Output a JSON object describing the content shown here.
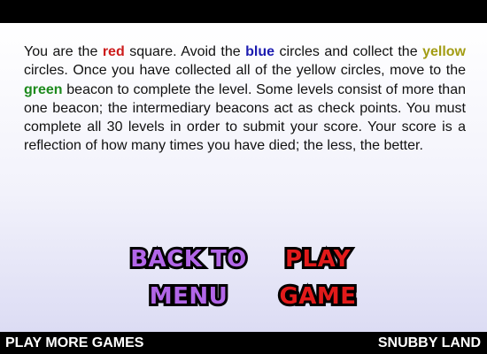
{
  "instructions": {
    "p1": "You are the ",
    "red_word": "red",
    "p2": " square.  Avoid the ",
    "blue_word": "blue",
    "p3": " circles and collect the ",
    "yellow_word": "yellow",
    "p4": " circles.  Once you have collected all of the yellow circles, move to the ",
    "green_word": "green",
    "p5": " beacon to complete the level. Some levels consist of more than one beacon; the intermediary beacons act as check points.  You must complete all 30 levels in order to submit your score.  Your score is a reflection of how many times you have died; the less, the better."
  },
  "buttons": {
    "back_line1": "BACK TO",
    "back_line2": "MENU",
    "play_line1": "PLAY",
    "play_line2": "GAME"
  },
  "footer": {
    "left_link": "PLAY MORE GAMES",
    "right_link": "SNUBBY LAND"
  },
  "colors": {
    "red": "#cc1b1b",
    "blue": "#1c1cb0",
    "yellow": "#a29c14",
    "green": "#1d8a1d",
    "back_button": "#b266e8",
    "play_button": "#e21a1a"
  }
}
